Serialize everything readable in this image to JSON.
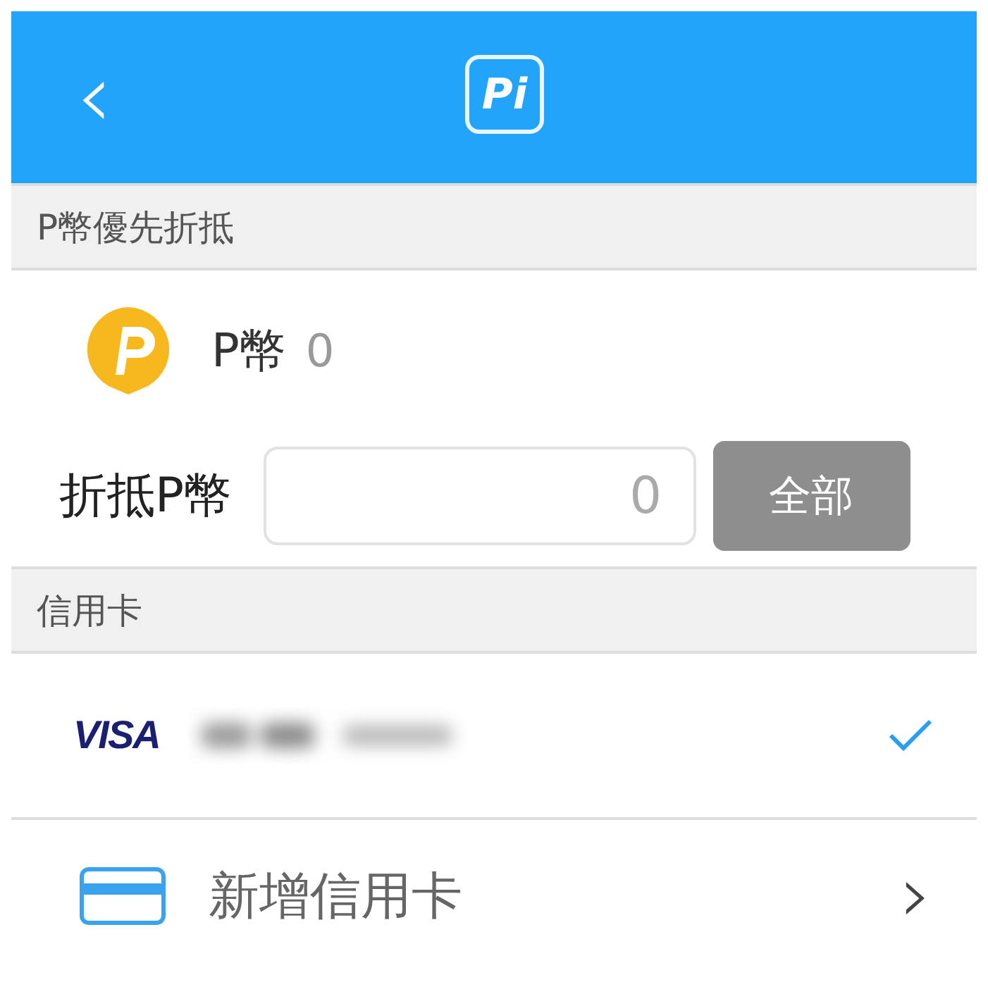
{
  "header": {
    "back": "‹",
    "logo": "Pi"
  },
  "coin_section": {
    "title": "P幣優先折抵"
  },
  "coin_balance": {
    "label": "P幣",
    "value": "0"
  },
  "redeem": {
    "label": "折抵P幣",
    "placeholder": "0",
    "button": "全部"
  },
  "card_section": {
    "title": "信用卡"
  },
  "cards": [
    {
      "brand": "VISA",
      "selected": true
    }
  ],
  "add_card": {
    "label": "新增信用卡",
    "chevron": "›"
  }
}
